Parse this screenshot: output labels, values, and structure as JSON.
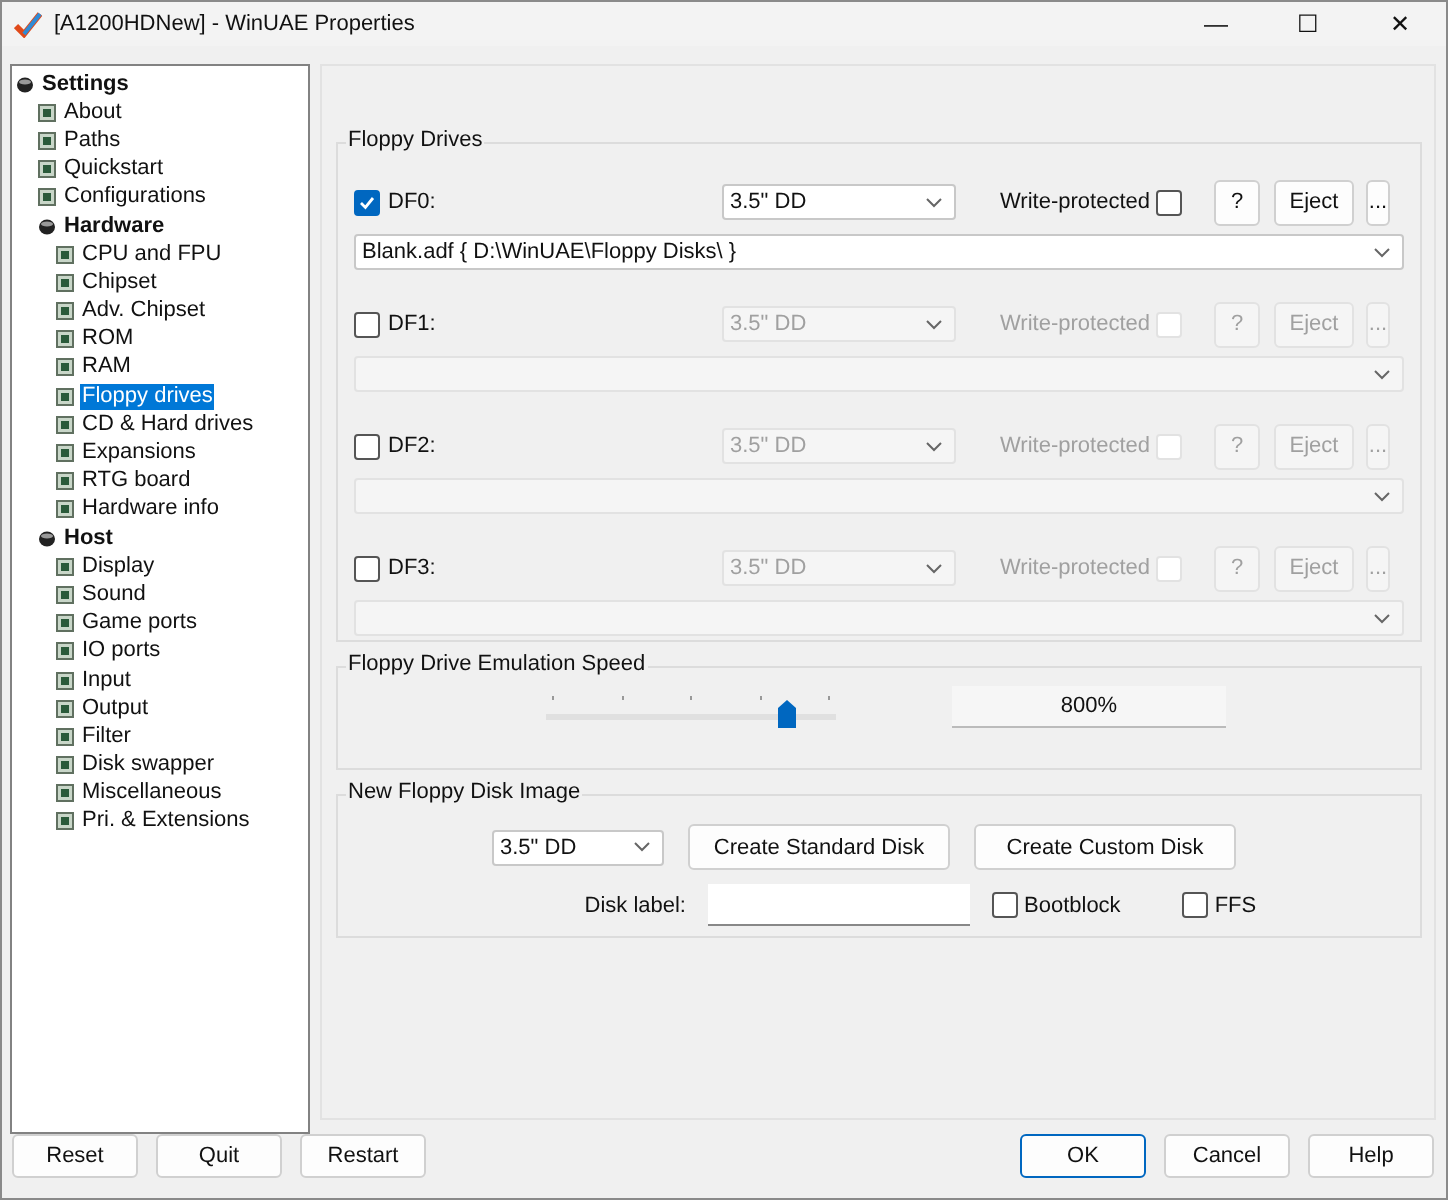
{
  "window": {
    "title": "[A1200HDNew] - WinUAE Properties",
    "controls": [
      "—",
      "☐",
      "✕"
    ]
  },
  "tree": [
    {
      "label": "Settings",
      "selected": false,
      "children": [
        {
          "label": "About",
          "selected": false
        },
        {
          "label": "Paths",
          "selected": false
        },
        {
          "label": "Quickstart",
          "selected": false
        },
        {
          "label": "Configurations",
          "selected": false
        },
        {
          "label": "Hardware",
          "selected": false,
          "children": [
            {
              "label": "CPU and FPU",
              "selected": false
            },
            {
              "label": "Chipset",
              "selected": false
            },
            {
              "label": "Adv. Chipset",
              "selected": false
            },
            {
              "label": "ROM",
              "selected": false
            },
            {
              "label": "RAM",
              "selected": false
            },
            {
              "label": "Floppy drives",
              "selected": true
            },
            {
              "label": "CD & Hard drives",
              "selected": false
            },
            {
              "label": "Expansions",
              "selected": false
            },
            {
              "label": "RTG board",
              "selected": false
            },
            {
              "label": "Hardware info",
              "selected": false
            }
          ]
        },
        {
          "label": "Host",
          "selected": false,
          "children": [
            {
              "label": "Display",
              "selected": false
            },
            {
              "label": "Sound",
              "selected": false
            },
            {
              "label": "Game ports",
              "selected": false
            },
            {
              "label": "IO ports",
              "selected": false
            },
            {
              "label": "Input",
              "selected": false
            },
            {
              "label": "Output",
              "selected": false
            },
            {
              "label": "Filter",
              "selected": false
            },
            {
              "label": "Disk swapper",
              "selected": false
            },
            {
              "label": "Miscellaneous",
              "selected": false
            },
            {
              "label": "Pri. & Extensions",
              "selected": false
            }
          ]
        }
      ]
    }
  ],
  "floppy_drives": {
    "title": "Floppy Drives",
    "drives": [
      {
        "label": "DF0:",
        "enabled": true,
        "type": "3.5\" DD",
        "write_protected_label": "Write-protected",
        "write_protected": false,
        "help": "?",
        "eject": "Eject",
        "browse": "...",
        "path": "Blank.adf { D:\\WinUAE\\Floppy Disks\\ }"
      },
      {
        "label": "DF1:",
        "enabled": false,
        "type": "3.5\" DD",
        "write_protected_label": "Write-protected",
        "write_protected": false,
        "help": "?",
        "eject": "Eject",
        "browse": "..."
      },
      {
        "label": "DF2:",
        "enabled": false,
        "type": "3.5\" DD",
        "write_protected_label": "Write-protected",
        "write_protected": false,
        "help": "?",
        "eject": "Eject",
        "browse": "..."
      },
      {
        "label": "DF3:",
        "enabled": false,
        "type": "3.5\" DD",
        "write_protected_label": "Write-protected",
        "write_protected": false,
        "help": "?",
        "eject": "Eject",
        "browse": "..."
      }
    ]
  },
  "emulation_speed": {
    "title": "Floppy Drive Emulation Speed",
    "level": 0.83,
    "reading": "800%"
  },
  "new_disk": {
    "title": "New Floppy Disk Image",
    "type": "3.5\" DD",
    "create_standard": "Create Standard Disk",
    "create_custom": "Create Custom Disk",
    "disk_label": "Disk label:",
    "bootblock": {
      "label": "Bootblock",
      "checked": false
    },
    "ffs": {
      "label": "FFS",
      "checked": false
    }
  },
  "buttons": [
    {
      "label": "Reset",
      "default": false
    },
    {
      "label": "Quit",
      "default": false
    },
    {
      "label": "Restart",
      "default": false
    },
    {
      "label": "OK",
      "default": true
    },
    {
      "label": "Cancel",
      "default": false
    },
    {
      "label": "Help",
      "default": false
    }
  ]
}
